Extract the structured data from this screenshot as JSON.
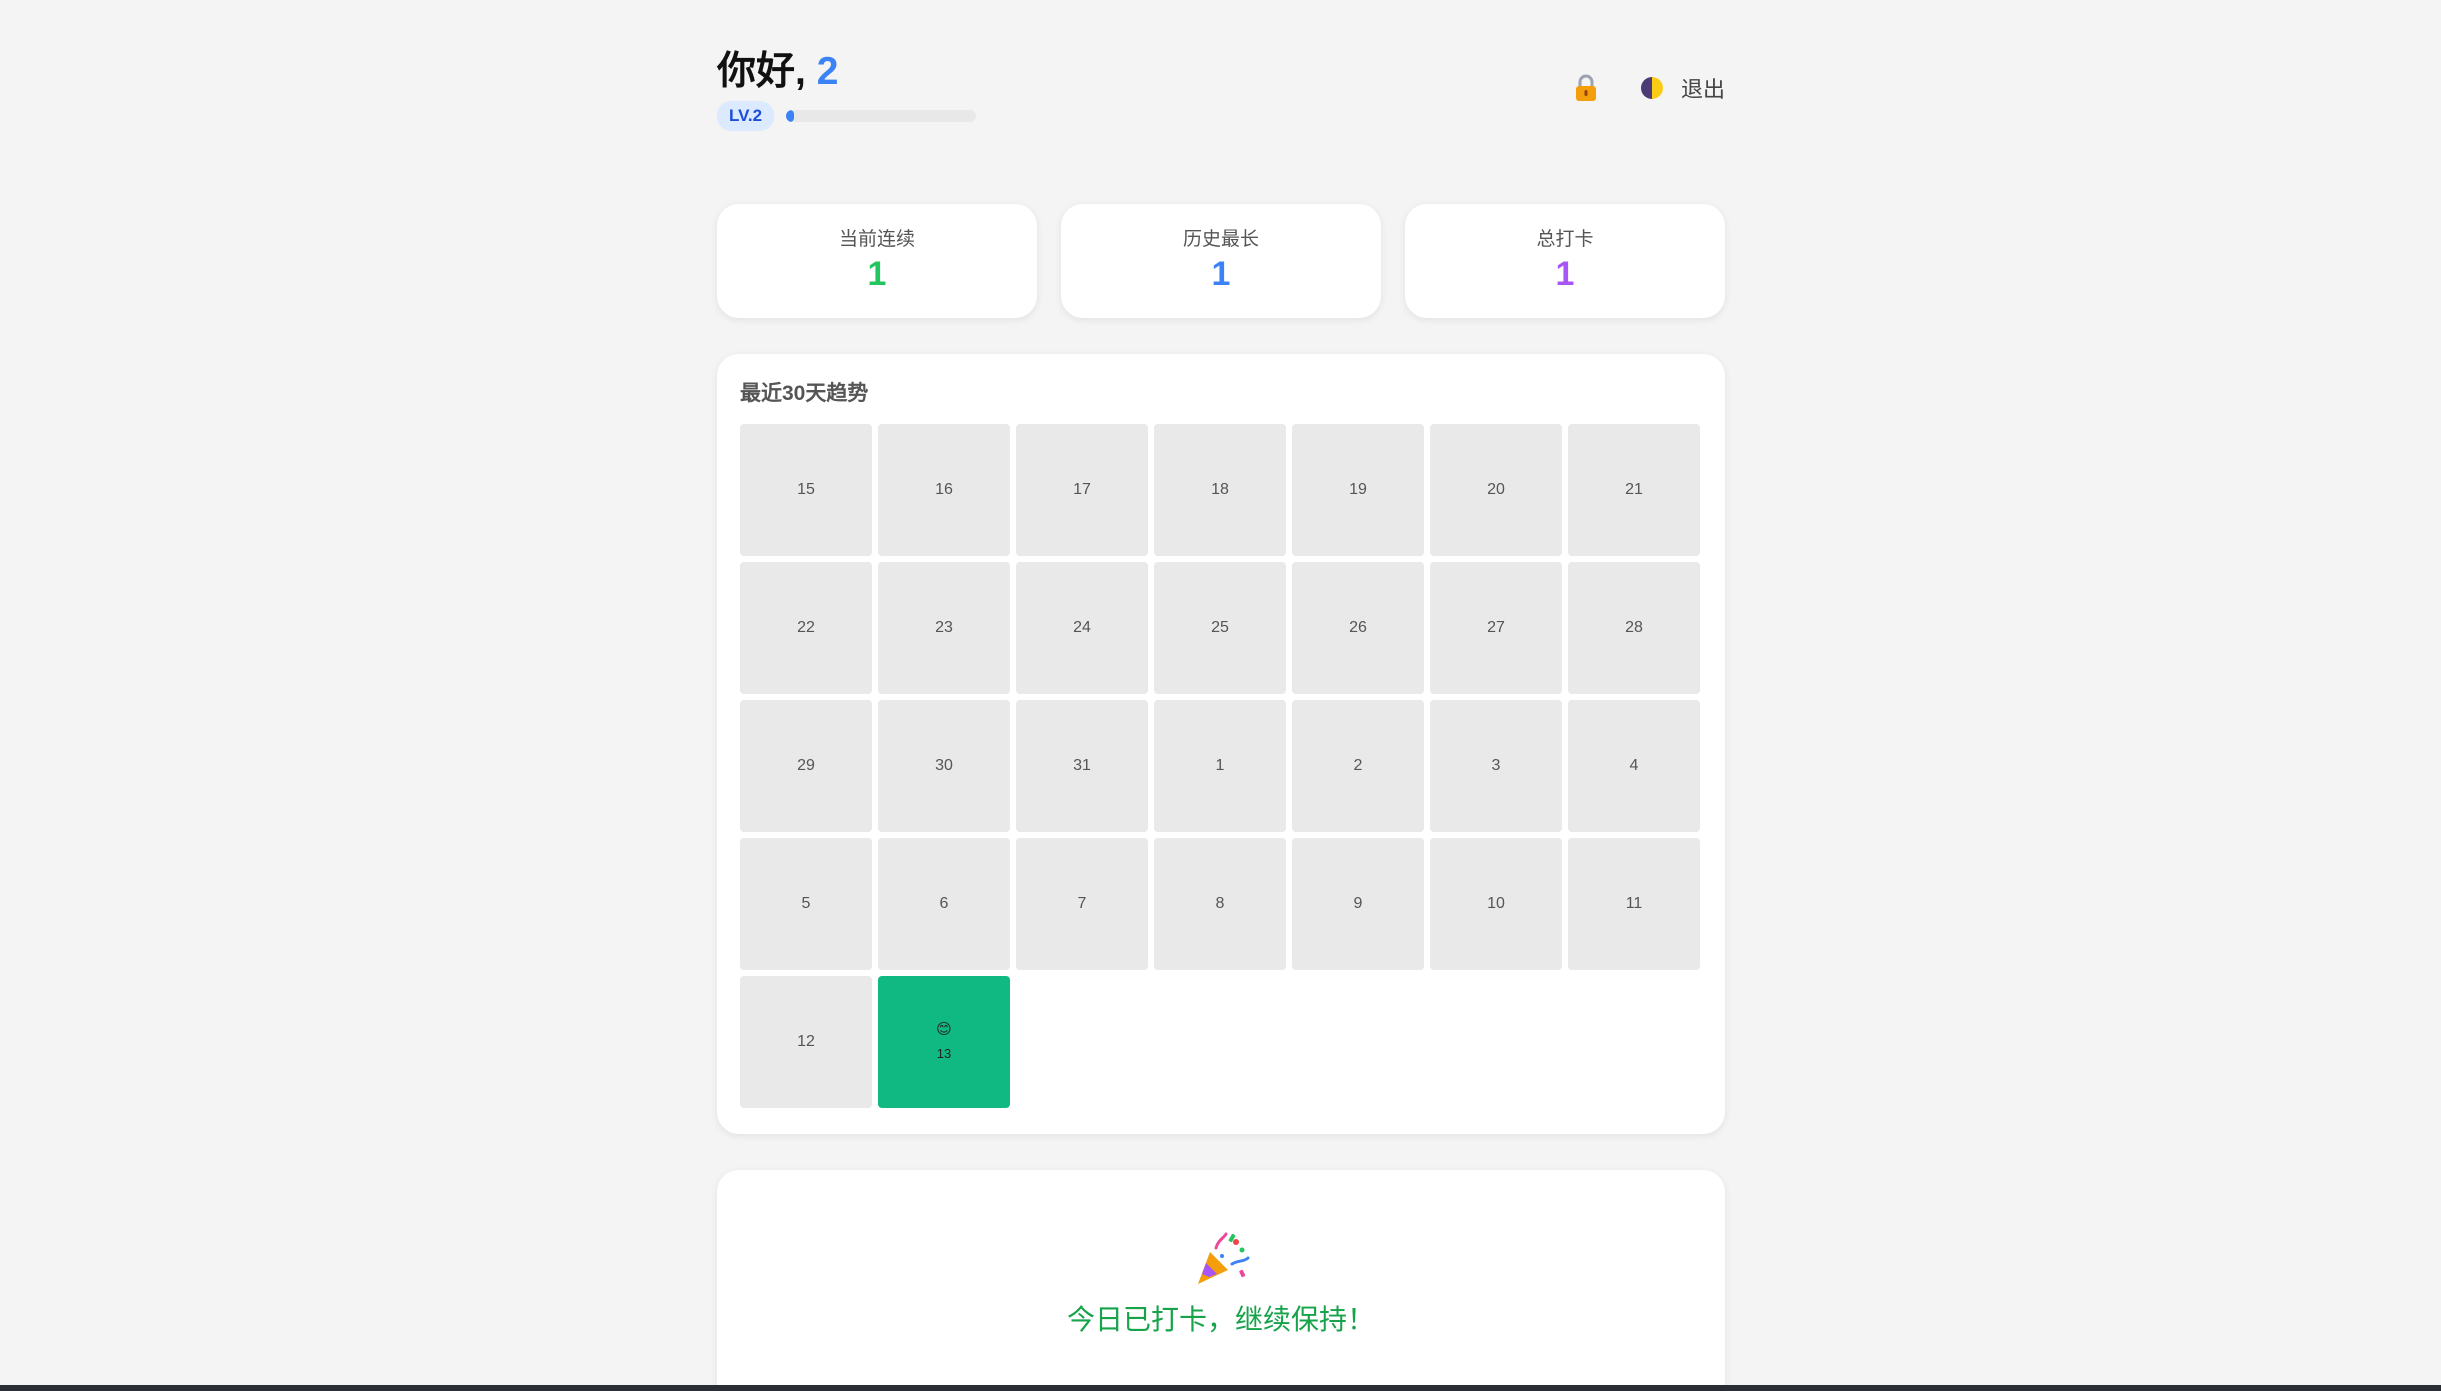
{
  "header": {
    "greeting_prefix": "你好,",
    "user_name": "2",
    "level_label": "LV.2",
    "level_progress_percent": 4,
    "logout_label": "退出"
  },
  "stats": [
    {
      "label": "当前连续",
      "value": "1",
      "color": "#22c55e"
    },
    {
      "label": "历史最长",
      "value": "1",
      "color": "#3b82f6"
    },
    {
      "label": "总打卡",
      "value": "1",
      "color": "#a855f7"
    }
  ],
  "trend": {
    "title": "最近30天趋势",
    "days": [
      {
        "day": "15",
        "done": false
      },
      {
        "day": "16",
        "done": false
      },
      {
        "day": "17",
        "done": false
      },
      {
        "day": "18",
        "done": false
      },
      {
        "day": "19",
        "done": false
      },
      {
        "day": "20",
        "done": false
      },
      {
        "day": "21",
        "done": false
      },
      {
        "day": "22",
        "done": false
      },
      {
        "day": "23",
        "done": false
      },
      {
        "day": "24",
        "done": false
      },
      {
        "day": "25",
        "done": false
      },
      {
        "day": "26",
        "done": false
      },
      {
        "day": "27",
        "done": false
      },
      {
        "day": "28",
        "done": false
      },
      {
        "day": "29",
        "done": false
      },
      {
        "day": "30",
        "done": false
      },
      {
        "day": "31",
        "done": false
      },
      {
        "day": "1",
        "done": false
      },
      {
        "day": "2",
        "done": false
      },
      {
        "day": "3",
        "done": false
      },
      {
        "day": "4",
        "done": false
      },
      {
        "day": "5",
        "done": false
      },
      {
        "day": "6",
        "done": false
      },
      {
        "day": "7",
        "done": false
      },
      {
        "day": "8",
        "done": false
      },
      {
        "day": "9",
        "done": false
      },
      {
        "day": "10",
        "done": false
      },
      {
        "day": "11",
        "done": false
      },
      {
        "day": "12",
        "done": false
      },
      {
        "day": "13",
        "done": true,
        "emoji": "😊"
      }
    ],
    "done_color": "#10b981"
  },
  "status": {
    "message": "今日已打卡，继续保持！"
  }
}
